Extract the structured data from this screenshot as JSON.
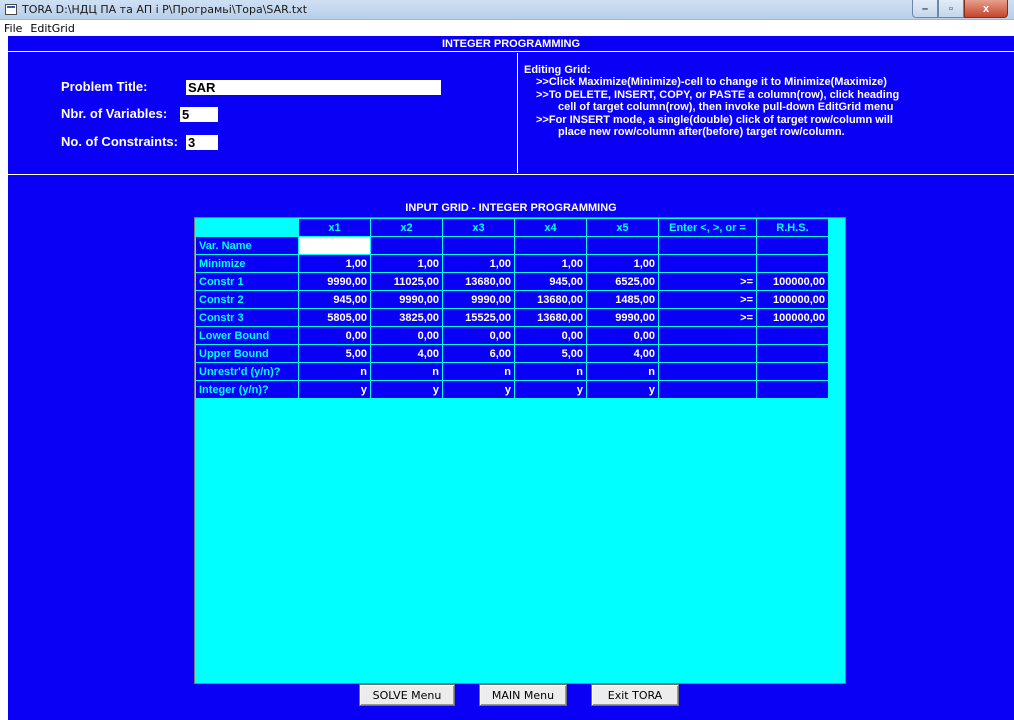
{
  "window": {
    "title": "TORA D:\\НДЦ ПА та АП і Р\\Програмьі\\Тора\\SAR.txt",
    "buttons": {
      "minimize": "–",
      "maximize": "▫",
      "close": "x"
    }
  },
  "menubar": [
    "File",
    "EditGrid"
  ],
  "section_title": "INTEGER PROGRAMMING",
  "problem": {
    "title_label": "Problem Title:",
    "title_value": "SAR",
    "vars_label": "Nbr. of Variables:",
    "vars_value": "5",
    "constraints_label": "No. of Constraints:",
    "constraints_value": "3"
  },
  "help": {
    "heading": "Editing Grid:",
    "lines": [
      ">>Click Maximize(Minimize)-cell to change it to Minimize(Maximize)",
      ">>To DELETE, INSERT, COPY, or PASTE a column(row), click heading",
      "cell of target column(row), then invoke pull-down EditGrid menu",
      ">>For INSERT mode, a single(double) click of target row/column will",
      "place new row/column after(before) target row/column."
    ]
  },
  "grid": {
    "title": "INPUT GRID - INTEGER PROGRAMMING",
    "columns": [
      "x1",
      "x2",
      "x3",
      "x4",
      "x5",
      "Enter <, >, or =",
      "R.H.S."
    ],
    "rows": [
      {
        "label": "Var. Name",
        "values": [
          "",
          "",
          "",
          "",
          ""
        ],
        "sign": "",
        "rhs": ""
      },
      {
        "label": "Minimize",
        "values": [
          "1,00",
          "1,00",
          "1,00",
          "1,00",
          "1,00"
        ],
        "sign": "",
        "rhs": ""
      },
      {
        "label": "Constr 1",
        "values": [
          "9990,00",
          "11025,00",
          "13680,00",
          "945,00",
          "6525,00"
        ],
        "sign": ">=",
        "rhs": "100000,00"
      },
      {
        "label": "Constr 2",
        "values": [
          "945,00",
          "9990,00",
          "9990,00",
          "13680,00",
          "1485,00"
        ],
        "sign": ">=",
        "rhs": "100000,00"
      },
      {
        "label": "Constr 3",
        "values": [
          "5805,00",
          "3825,00",
          "15525,00",
          "13680,00",
          "9990,00"
        ],
        "sign": ">=",
        "rhs": "100000,00"
      },
      {
        "label": "Lower Bound",
        "values": [
          "0,00",
          "0,00",
          "0,00",
          "0,00",
          "0,00"
        ],
        "sign": "",
        "rhs": ""
      },
      {
        "label": "Upper Bound",
        "values": [
          "5,00",
          "4,00",
          "6,00",
          "5,00",
          "4,00"
        ],
        "sign": "",
        "rhs": ""
      },
      {
        "label": "Unrestr'd (y/n)?",
        "values": [
          "n",
          "n",
          "n",
          "n",
          "n"
        ],
        "sign": "",
        "rhs": ""
      },
      {
        "label": "Integer (y/n)?",
        "values": [
          "y",
          "y",
          "y",
          "y",
          "y"
        ],
        "sign": "",
        "rhs": ""
      }
    ]
  },
  "buttons": {
    "solve": "SOLVE Menu",
    "main": "MAIN Menu",
    "exit": "Exit TORA"
  },
  "colors": {
    "background_blue": "#0a00f5",
    "grid_cyan": "#00ffff",
    "text_white": "#ffffff"
  }
}
